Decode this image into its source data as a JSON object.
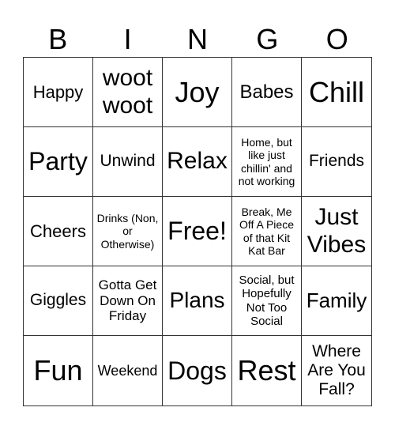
{
  "header": [
    "B",
    "I",
    "N",
    "G",
    "O"
  ],
  "cells": [
    "Happy",
    "woot woot",
    "Joy",
    "Babes",
    "Chill",
    "Party",
    "Unwind",
    "Relax",
    "Home, but like just chillin' and not working",
    "Friends",
    "Cheers",
    "Drinks (Non, or Otherwise)",
    "Free!",
    "Break, Me Off A Piece of that Kit Kat Bar",
    "Just Vibes",
    "Giggles",
    "Gotta Get Down On Friday",
    "Plans",
    "Social, but Hopefully Not Too Social",
    "Family",
    "Fun",
    "Weekend",
    "Dogs",
    "Rest",
    "Where Are You Fall?"
  ]
}
